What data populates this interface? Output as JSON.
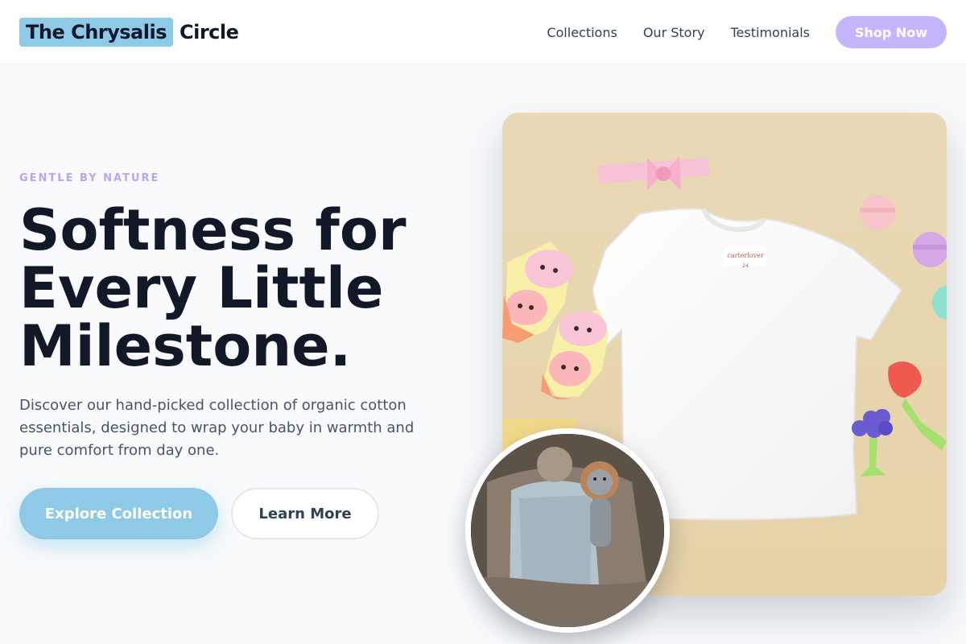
{
  "brand": {
    "name_highlight": "The Chrysalis",
    "name_rest": "Circle",
    "highlight_color": "#8ecae6"
  },
  "nav": {
    "links": [
      "Collections",
      "Our Story",
      "Testimonials"
    ],
    "cta_label": "Shop Now",
    "cta_color": "#c4b5fd"
  },
  "hero": {
    "eyebrow": "GENTLE BY NATURE",
    "headline_lines": [
      "Softness for",
      "Every Little",
      "Milestone."
    ],
    "lead": "Discover our hand-picked collection of organic cotton essentials, designed to wrap your baby in warmth and pure comfort from day one.",
    "primary_cta": "Explore Collection",
    "secondary_cta": "Learn More",
    "accent_color": "#b4a7f5"
  },
  "images": {
    "main_photo": "baby-clothes-flatlay-photo",
    "shirt_tag": "carterlover",
    "shirt_size": "24",
    "inset_photo": "newborn-outfit-with-knitted-lion-photo"
  }
}
